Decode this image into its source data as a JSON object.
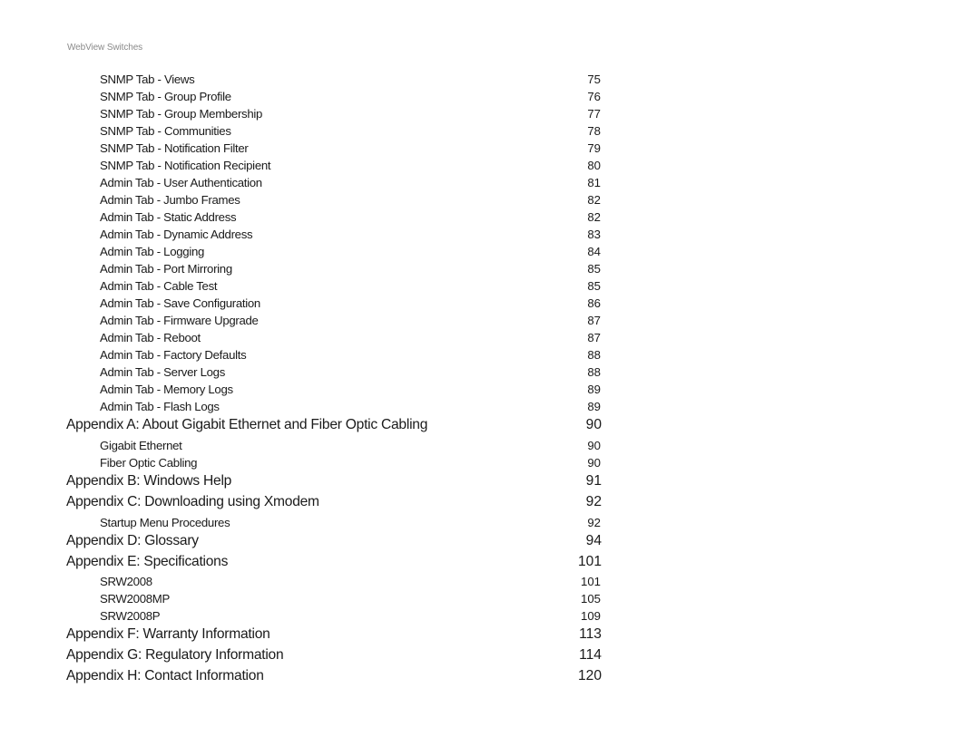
{
  "header": {
    "running_title": "WebView Switches"
  },
  "toc": [
    {
      "level": "sub",
      "label": "SNMP Tab - Views",
      "page": "75"
    },
    {
      "level": "sub",
      "label": "SNMP Tab - Group Profile",
      "page": "76"
    },
    {
      "level": "sub",
      "label": "SNMP Tab - Group Membership",
      "page": "77"
    },
    {
      "level": "sub",
      "label": "SNMP Tab - Communities",
      "page": "78"
    },
    {
      "level": "sub",
      "label": "SNMP Tab - Notification Filter",
      "page": "79"
    },
    {
      "level": "sub",
      "label": "SNMP Tab - Notification Recipient",
      "page": "80"
    },
    {
      "level": "sub",
      "label": "Admin Tab - User Authentication",
      "page": "81"
    },
    {
      "level": "sub",
      "label": "Admin Tab - Jumbo Frames",
      "page": "82"
    },
    {
      "level": "sub",
      "label": "Admin Tab - Static Address",
      "page": "82"
    },
    {
      "level": "sub",
      "label": "Admin Tab - Dynamic Address",
      "page": "83"
    },
    {
      "level": "sub",
      "label": "Admin Tab - Logging",
      "page": "84"
    },
    {
      "level": "sub",
      "label": "Admin Tab - Port Mirroring",
      "page": "85"
    },
    {
      "level": "sub",
      "label": "Admin Tab - Cable Test",
      "page": "85"
    },
    {
      "level": "sub",
      "label": "Admin Tab - Save Configuration",
      "page": "86"
    },
    {
      "level": "sub",
      "label": "Admin Tab - Firmware Upgrade",
      "page": "87"
    },
    {
      "level": "sub",
      "label": "Admin Tab - Reboot",
      "page": "87"
    },
    {
      "level": "sub",
      "label": "Admin Tab - Factory Defaults",
      "page": "88"
    },
    {
      "level": "sub",
      "label": "Admin Tab - Server Logs",
      "page": "88"
    },
    {
      "level": "sub",
      "label": "Admin Tab - Memory Logs",
      "page": "89"
    },
    {
      "level": "sub",
      "label": "Admin Tab - Flash Logs",
      "page": "89"
    },
    {
      "level": "main",
      "label": "Appendix A: About Gigabit Ethernet and Fiber Optic Cabling",
      "page": "90"
    },
    {
      "level": "sub",
      "label": "Gigabit Ethernet",
      "page": "90"
    },
    {
      "level": "sub",
      "label": "Fiber Optic Cabling",
      "page": "90"
    },
    {
      "level": "main",
      "label": "Appendix B: Windows Help",
      "page": "91"
    },
    {
      "level": "main",
      "label": "Appendix C: Downloading using Xmodem",
      "page": "92"
    },
    {
      "level": "sub",
      "label": "Startup Menu Procedures",
      "page": "92"
    },
    {
      "level": "main",
      "label": "Appendix D: Glossary",
      "page": "94"
    },
    {
      "level": "main",
      "label": "Appendix E: Specifications",
      "page": "101"
    },
    {
      "level": "sub",
      "label": "SRW2008",
      "page": "101"
    },
    {
      "level": "sub",
      "label": "SRW2008MP",
      "page": "105"
    },
    {
      "level": "sub",
      "label": "SRW2008P",
      "page": "109"
    },
    {
      "level": "main",
      "label": "Appendix F: Warranty Information",
      "page": "113"
    },
    {
      "level": "main",
      "label": "Appendix G: Regulatory Information",
      "page": "114"
    },
    {
      "level": "main",
      "label": "Appendix H: Contact Information",
      "page": "120"
    }
  ]
}
